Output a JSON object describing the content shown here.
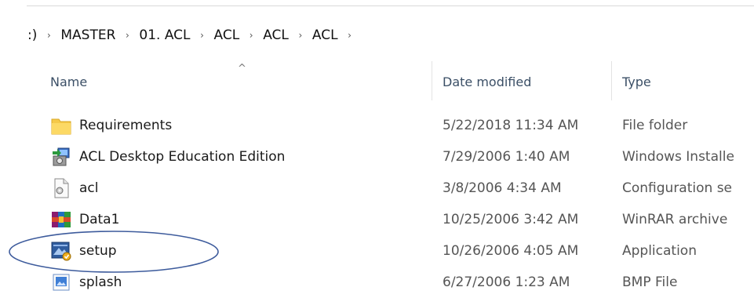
{
  "breadcrumb": {
    "items": [
      ":)",
      "MASTER",
      "01. ACL",
      "ACL",
      "ACL",
      "ACL"
    ],
    "separator": "›"
  },
  "columns": {
    "name": "Name",
    "date": "Date modified",
    "type": "Type",
    "sort_indicator": "^"
  },
  "files": [
    {
      "name": "Requirements",
      "date": "5/22/2018 11:34 AM",
      "type": "File folder",
      "icon": "folder-icon"
    },
    {
      "name": "ACL Desktop Education Edition",
      "date": "7/29/2006 1:40 AM",
      "type": "Windows Installe",
      "icon": "installer-icon"
    },
    {
      "name": "acl",
      "date": "3/8/2006 4:34 AM",
      "type": "Configuration se",
      "icon": "config-file-icon"
    },
    {
      "name": "Data1",
      "date": "10/25/2006 3:42 AM",
      "type": "WinRAR archive",
      "icon": "winrar-icon"
    },
    {
      "name": "setup",
      "date": "10/26/2006 4:05 AM",
      "type": "Application",
      "icon": "setup-app-icon"
    },
    {
      "name": "splash",
      "date": "6/27/2006 1:23 AM",
      "type": "BMP File",
      "icon": "bmp-image-icon"
    }
  ],
  "colors": {
    "header_text": "#3b4f66",
    "annotation_ellipse": "#3d5b9c",
    "folder": "#f5c94a"
  }
}
